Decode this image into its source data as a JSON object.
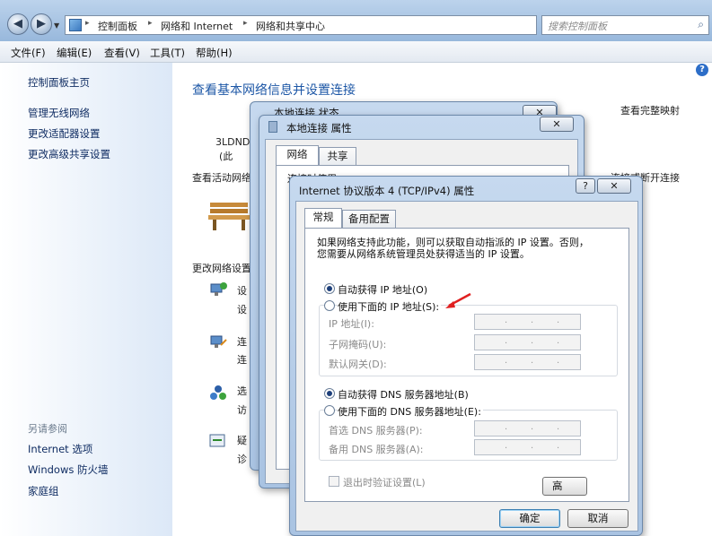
{
  "explorer": {
    "breadcrumb": [
      "控制面板",
      "网络和 Internet",
      "网络和共享中心"
    ],
    "search_placeholder": "搜索控制面板",
    "menu": [
      "文件(F)",
      "编辑(E)",
      "查看(V)",
      "工具(T)",
      "帮助(H)"
    ],
    "sidebar": {
      "items": [
        "控制面板主页",
        "管理无线网络",
        "更改适配器设置",
        "更改高级共享设置"
      ],
      "see_also_label": "另请参阅",
      "see_also": [
        "Internet 选项",
        "Windows 防火墙",
        "家庭组"
      ]
    },
    "main": {
      "title": "查看基本网络信息并设置连接",
      "full_map_link": "查看完整映射",
      "computer_name": "3LDND",
      "computer_sub": "(此",
      "active_networks_label": "查看活动网络",
      "connect_link": "连接或断开连接",
      "change_settings_label": "更改网络设置",
      "rows": [
        {
          "icon": "network-setup-icon",
          "line1": "设",
          "line2": "设"
        },
        {
          "icon": "connect-network-icon",
          "line1": "连",
          "line2": "连"
        },
        {
          "icon": "homegroup-icon",
          "line1": "选",
          "line2": "访"
        },
        {
          "icon": "troubleshoot-icon",
          "line1": "疑",
          "line2": "诊"
        }
      ]
    }
  },
  "status_dialog": {
    "title": "本地连接 状态",
    "close": "✕"
  },
  "props_dialog": {
    "title": "本地连接 属性",
    "close": "✕",
    "tabs": [
      "网络",
      "共享"
    ],
    "connect_using": "连接时使用:"
  },
  "ipv4_dialog": {
    "title": "Internet 协议版本 4 (TCP/IPv4) 属性",
    "help": "?",
    "close": "✕",
    "tabs": [
      "常规",
      "备用配置"
    ],
    "description": [
      "如果网络支持此功能，则可以获取自动指派的 IP 设置。否则，",
      "您需要从网络系统管理员处获得适当的 IP 设置。"
    ],
    "auto_ip": "自动获得 IP 地址(O)",
    "manual_ip": "使用下面的 IP 地址(S):",
    "ip_label": "IP 地址(I):",
    "mask_label": "子网掩码(U):",
    "gateway_label": "默认网关(D):",
    "auto_dns": "自动获得 DNS 服务器地址(B)",
    "manual_dns": "使用下面的 DNS 服务器地址(E):",
    "dns1_label": "首选 DNS 服务器(P):",
    "dns2_label": "备用 DNS 服务器(A):",
    "validate_on_exit": "退出时验证设置(L)",
    "advanced": "高",
    "ok": "确定",
    "cancel": "取消",
    "auto_ip_selected": true,
    "auto_dns_selected": true
  },
  "colors": {
    "link": "#0f3f98",
    "title": "#1d57a6",
    "annotation_arrow": "#e02020"
  }
}
